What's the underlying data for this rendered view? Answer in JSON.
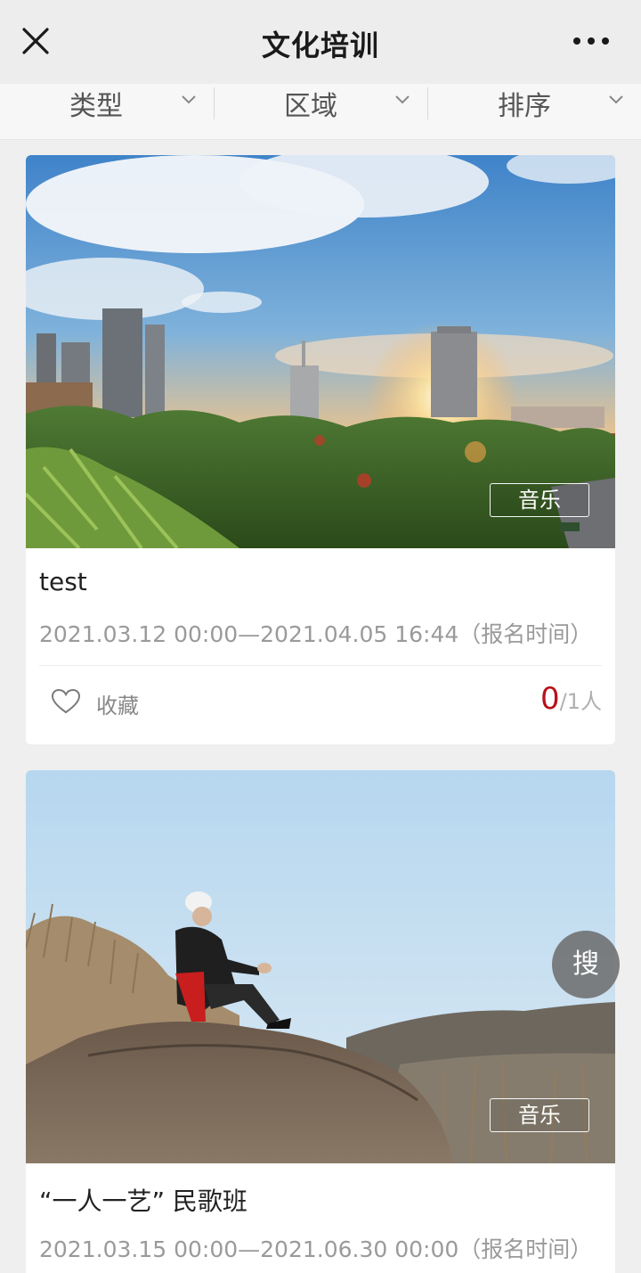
{
  "nav": {
    "title": "文化培训",
    "close_icon": "close-icon",
    "more_icon": "more-dots-icon"
  },
  "filters": [
    {
      "label": "类型"
    },
    {
      "label": "区域"
    },
    {
      "label": "排序"
    }
  ],
  "cards": [
    {
      "tag": "音乐",
      "title": "test",
      "time": "2021.03.12 00:00—2021.04.05 16:44（报名时间）",
      "favorite_label": "收藏",
      "count_now": "0",
      "count_total": "/1人"
    },
    {
      "tag": "音乐",
      "title": "“一人一艺” 民歌班",
      "time": "2021.03.15 00:00—2021.06.30 00:00（报名时间）"
    }
  ],
  "float_search": {
    "label": "搜"
  },
  "colors": {
    "accent_red": "#b5121b",
    "nav_bg": "#ededed",
    "page_bg": "#efefef"
  }
}
